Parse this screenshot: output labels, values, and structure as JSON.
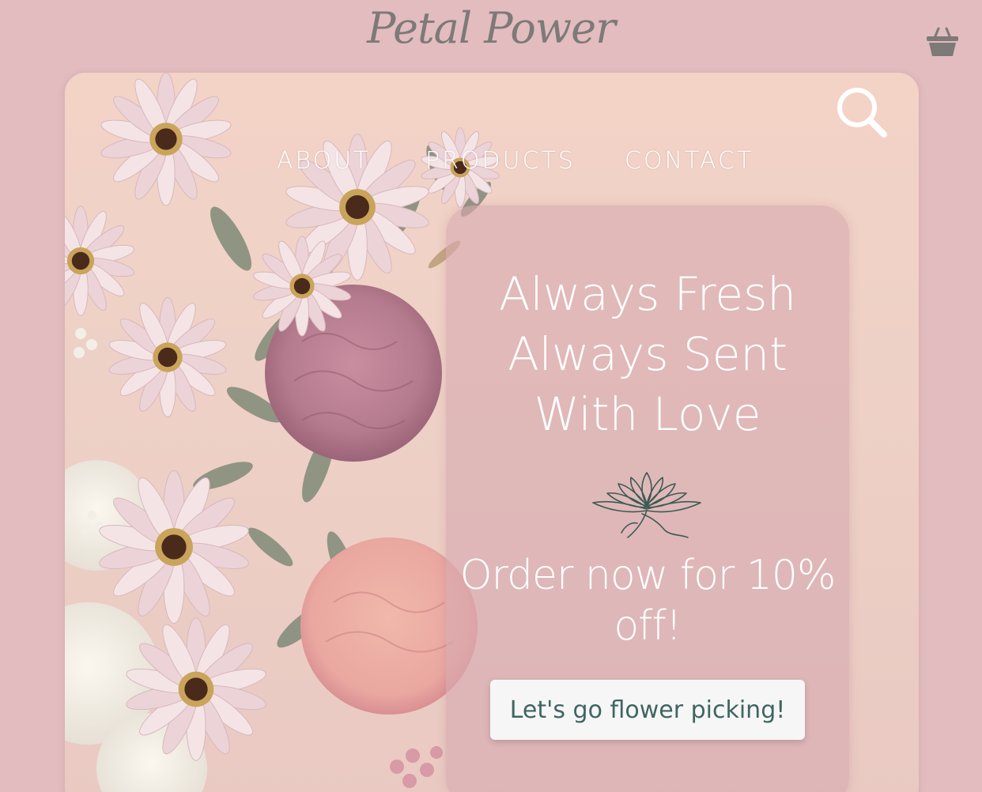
{
  "header": {
    "brand": "Petal Power",
    "cart_icon": "basket-icon"
  },
  "nav": {
    "search_icon": "search-icon",
    "items": [
      {
        "label": "ABOUT"
      },
      {
        "label": "PRODUCTS"
      },
      {
        "label": "CONTACT"
      }
    ]
  },
  "hero": {
    "image": "flower-bouquet-photo",
    "headline": [
      "Always Fresh",
      "Always Sent",
      "With Love"
    ],
    "decoration_icon": "lotus-icon",
    "offer": [
      "Order now for 10%",
      "off!"
    ],
    "cta_label": "Let's go flower picking!"
  },
  "colors": {
    "page_bg": "#e3bcbf",
    "brand_text": "#7d7a78",
    "cta_text": "#3f6560",
    "lotus_stroke": "#3d5a55"
  }
}
